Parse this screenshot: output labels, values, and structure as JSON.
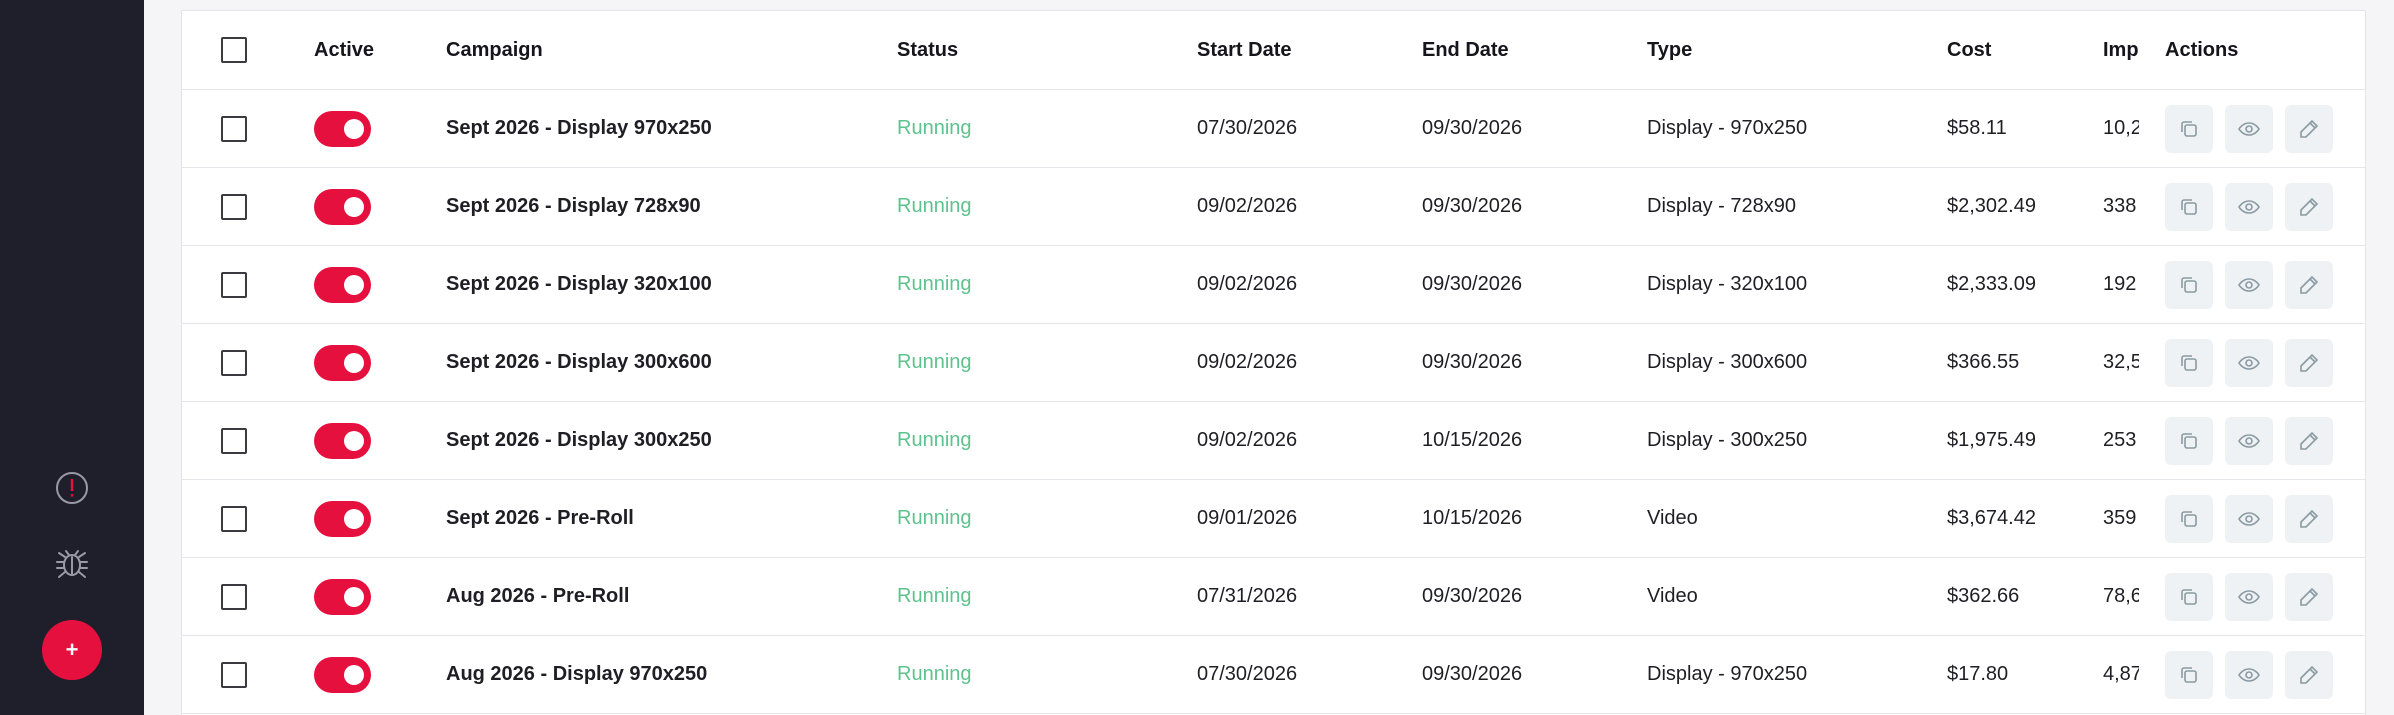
{
  "sidebar": {
    "icons": [
      "alert-icon",
      "bug-icon",
      "plus-icon"
    ],
    "add_label": "+",
    "accent_color": "#e6103f",
    "bg_color": "#1f1f2b"
  },
  "table": {
    "headers": {
      "active": "Active",
      "campaign": "Campaign",
      "status": "Status",
      "start_date": "Start Date",
      "end_date": "End Date",
      "type": "Type",
      "cost": "Cost",
      "impressions": "Imp",
      "actions": "Actions"
    },
    "rows": [
      {
        "active": true,
        "campaign": "Sept 2026 - Display 970x250",
        "status": "Running",
        "start": "07/30/2026",
        "end": "09/30/2026",
        "type": "Display - 970x250",
        "cost": "$58.11",
        "imp": "10,2"
      },
      {
        "active": true,
        "campaign": "Sept 2026 - Display 728x90",
        "status": "Running",
        "start": "09/02/2026",
        "end": "09/30/2026",
        "type": "Display - 728x90",
        "cost": "$2,302.49",
        "imp": "338"
      },
      {
        "active": true,
        "campaign": "Sept 2026 - Display 320x100",
        "status": "Running",
        "start": "09/02/2026",
        "end": "09/30/2026",
        "type": "Display - 320x100",
        "cost": "$2,333.09",
        "imp": "192"
      },
      {
        "active": true,
        "campaign": "Sept 2026 - Display 300x600",
        "status": "Running",
        "start": "09/02/2026",
        "end": "09/30/2026",
        "type": "Display - 300x600",
        "cost": "$366.55",
        "imp": "32,5"
      },
      {
        "active": true,
        "campaign": "Sept 2026 - Display 300x250",
        "status": "Running",
        "start": "09/02/2026",
        "end": "10/15/2026",
        "type": "Display - 300x250",
        "cost": "$1,975.49",
        "imp": "253"
      },
      {
        "active": true,
        "campaign": "Sept 2026 - Pre-Roll",
        "status": "Running",
        "start": "09/01/2026",
        "end": "10/15/2026",
        "type": "Video",
        "cost": "$3,674.42",
        "imp": "359"
      },
      {
        "active": true,
        "campaign": "Aug 2026 - Pre-Roll",
        "status": "Running",
        "start": "07/31/2026",
        "end": "09/30/2026",
        "type": "Video",
        "cost": "$362.66",
        "imp": "78,6"
      },
      {
        "active": true,
        "campaign": "Aug 2026 - Display 970x250",
        "status": "Running",
        "start": "07/30/2026",
        "end": "09/30/2026",
        "type": "Display - 970x250",
        "cost": "$17.80",
        "imp": "4,87"
      }
    ],
    "row_action_icons": [
      "copy-icon",
      "eye-icon",
      "edit-icon"
    ],
    "status_color": "#5ec28d",
    "toggle_color": "#e6103f"
  }
}
